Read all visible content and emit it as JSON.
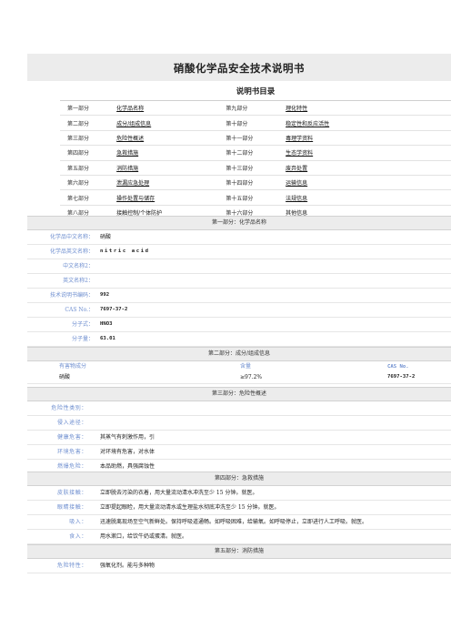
{
  "title": "硝酸化学品安全技术说明书",
  "toc": {
    "heading": "说明书目录",
    "rows": [
      {
        "p1": "第一部分",
        "l1": "化学品名称",
        "p2": "第九部分",
        "l2": "理化特性"
      },
      {
        "p1": "第二部分",
        "l1": "成分/组成信息",
        "p2": "第十部分",
        "l2": "稳定性和反应活性"
      },
      {
        "p1": "第三部分",
        "l1": "危险性概述",
        "p2": "第十一部分",
        "l2": "毒理学资料"
      },
      {
        "p1": "第四部分",
        "l1": "急救措施",
        "p2": "第十二部分",
        "l2": "生态学资料"
      },
      {
        "p1": "第五部分",
        "l1": "消防措施",
        "p2": "第十三部分",
        "l2": "废弃处置"
      },
      {
        "p1": "第六部分",
        "l1": "泄漏应急处理",
        "p2": "第十四部分",
        "l2": "运输信息"
      },
      {
        "p1": "第七部分",
        "l1": "操作处置与储存",
        "p2": "第十五部分",
        "l2": "法规信息"
      },
      {
        "p1": "第八部分",
        "l1": "接触控制/个体防护",
        "p2": "第十六部分",
        "l2": "其他信息"
      }
    ]
  },
  "s1": {
    "header": "第一部分：化学品名称",
    "rows": [
      {
        "k": "化学品中文名称：",
        "v": "硝酸"
      },
      {
        "k": "化学品英文名称：",
        "v": "nitric acid"
      },
      {
        "k": "中文名称2：",
        "v": ""
      },
      {
        "k": "英文名称2：",
        "v": ""
      },
      {
        "k": "技术说明书编码：",
        "v": "992"
      },
      {
        "k": "CAS No.：",
        "v": "7697-37-2"
      },
      {
        "k": "分子式：",
        "v": "HNO3"
      },
      {
        "k": "分子量：",
        "v": "63.01"
      }
    ]
  },
  "s2": {
    "header": "第二部分：成分/组成信息",
    "col_a": "有害物成分",
    "col_b": "含量",
    "col_c": "CAS No.",
    "name": "硝酸",
    "content": "≥97.2%",
    "cas": "7697-37-2"
  },
  "s3": {
    "header": "第三部分：危险性概述",
    "rows": [
      {
        "k": "危险性类别：",
        "v": ""
      },
      {
        "k": "侵入途径：",
        "v": ""
      },
      {
        "k": "健康危害：",
        "v": "其蒸气有刺激作用，引"
      },
      {
        "k": "环境危害：",
        "v": "对环境有危害，对水体"
      },
      {
        "k": "燃爆危险：",
        "v": "本品助燃，具强腐蚀性"
      }
    ]
  },
  "s4": {
    "header": "第四部分：急救措施",
    "rows": [
      {
        "k": "皮肤接触：",
        "v": "立即脱去污染的衣着，用大量流动清水冲洗至少 15 分钟。就医。"
      },
      {
        "k": "眼睛接触：",
        "v": "立即提起眼睑，用大量流动清水或生理盐水彻底冲洗至少 15 分钟。就医。"
      },
      {
        "k": "吸入：",
        "v": "迅速脱离现场至空气新鲜处。保持呼吸道通畅。如呼吸困难，给输氧。如呼吸停止，立即进行人工呼吸。就医。"
      },
      {
        "k": "食入：",
        "v": "用水漱口，给饮牛奶或蛋清。就医。"
      }
    ]
  },
  "s5": {
    "header": "第五部分：消防措施",
    "rows": [
      {
        "k": "危险特性：",
        "v": "强氧化剂。能与多种物"
      }
    ]
  }
}
